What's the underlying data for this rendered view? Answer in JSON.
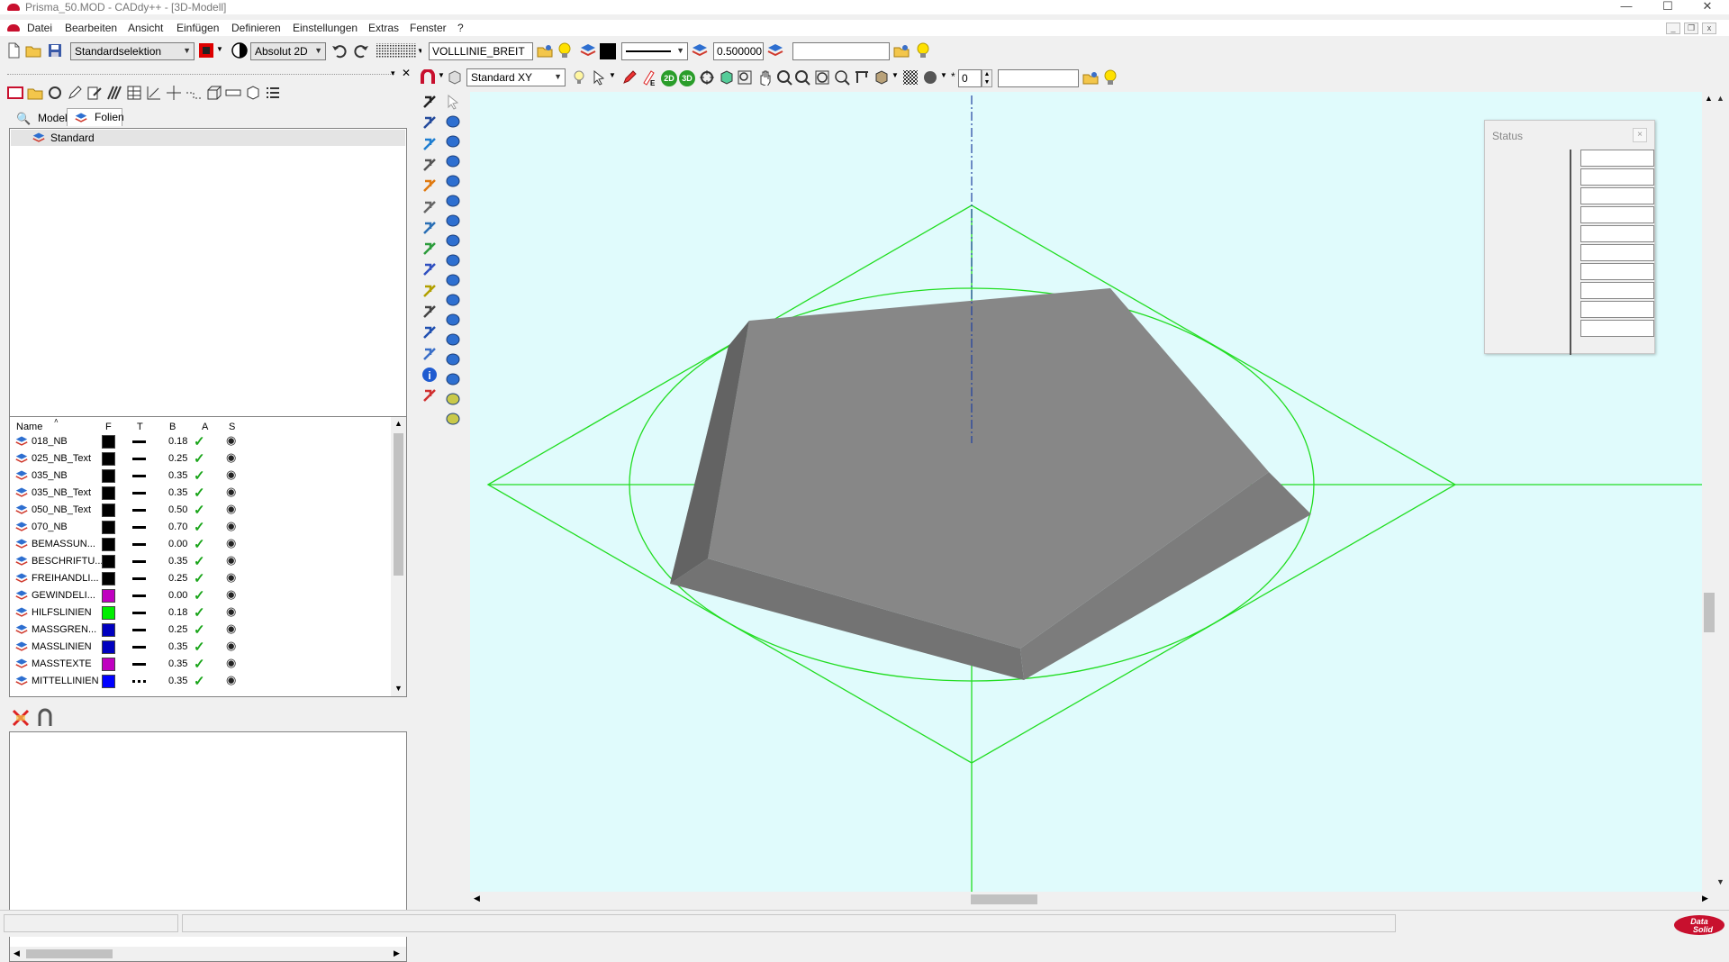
{
  "window": {
    "title": "Prisma_50.MOD  - CADdy++ - [3D-Modell]",
    "minimize": "—",
    "maximize": "☐",
    "close": "✕"
  },
  "menu": {
    "items": [
      "Datei",
      "Bearbeiten",
      "Ansicht",
      "Einfügen",
      "Definieren",
      "Einstellungen",
      "Extras",
      "Fenster",
      "?"
    ]
  },
  "toolbar1": {
    "selection_mode": "Standardselektion",
    "coord_mode": "Absolut 2D",
    "linetype": "VOLLLINIE_BREIT",
    "linewidth": "0.500000",
    "extra_field": ""
  },
  "toolbar2": {
    "view": "Standard XY",
    "spin_value": "0",
    "btn_2d": "2D",
    "btn_3d": "3D",
    "extra_field": ""
  },
  "left_panel": {
    "tabs": [
      {
        "label": "Modell"
      },
      {
        "label": "Folien"
      }
    ],
    "tree_items": [
      {
        "label": "Standard"
      }
    ],
    "columns": [
      "Name",
      "F",
      "T",
      "B",
      "A",
      "S"
    ],
    "layers": [
      {
        "name": "018_NB",
        "color": "#000000",
        "line": "solid",
        "width": "0.18"
      },
      {
        "name": "025_NB_Text",
        "color": "#000000",
        "line": "solid",
        "width": "0.25"
      },
      {
        "name": "035_NB",
        "color": "#000000",
        "line": "solid",
        "width": "0.35"
      },
      {
        "name": "035_NB_Text",
        "color": "#000000",
        "line": "solid",
        "width": "0.35"
      },
      {
        "name": "050_NB_Text",
        "color": "#000000",
        "line": "solid",
        "width": "0.50"
      },
      {
        "name": "070_NB",
        "color": "#000000",
        "line": "solid",
        "width": "0.70"
      },
      {
        "name": "BEMASSUN...",
        "color": "#000000",
        "line": "solid",
        "width": "0.00"
      },
      {
        "name": "BESCHRIFTU...",
        "color": "#000000",
        "line": "solid",
        "width": "0.35"
      },
      {
        "name": "FREIHANDLI...",
        "color": "#000000",
        "line": "solid",
        "width": "0.25"
      },
      {
        "name": "GEWINDELI...",
        "color": "#c000c0",
        "line": "solid",
        "width": "0.00"
      },
      {
        "name": "HILFSLINIEN",
        "color": "#00ee00",
        "line": "solid",
        "width": "0.18"
      },
      {
        "name": "MASSGREN...",
        "color": "#0000c0",
        "line": "solid",
        "width": "0.25"
      },
      {
        "name": "MASSLINIEN",
        "color": "#0000c0",
        "line": "solid",
        "width": "0.35"
      },
      {
        "name": "MASSTEXTE",
        "color": "#c000c0",
        "line": "solid",
        "width": "0.35"
      },
      {
        "name": "MITTELLINIEN",
        "color": "#0000ff",
        "line": "dashdot",
        "width": "0.35"
      }
    ]
  },
  "status_window": {
    "title": "Status",
    "cells": 10
  },
  "colors": {
    "viewport_bg": "#e0fbfc",
    "construction_green": "#22dd22",
    "axis_blue": "#2040a0",
    "prism_top": "#878787",
    "accent_red": "#c8102e"
  },
  "logo": "Data Solid"
}
